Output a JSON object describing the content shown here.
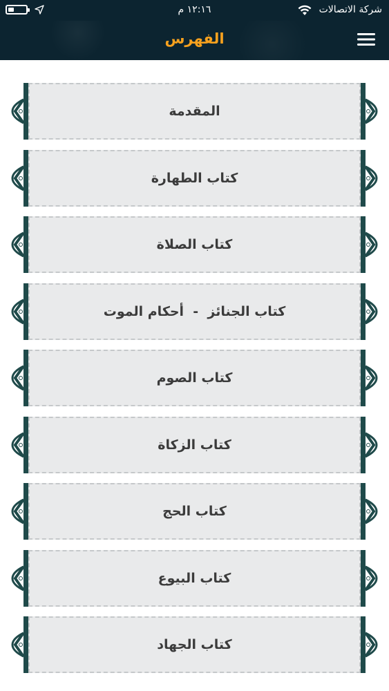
{
  "status_bar": {
    "carrier": "شركة الاتصالات",
    "time": "١٢:١٦ م",
    "battery_level": 0.35,
    "wifi_icon": "wifi-icon",
    "location_icon": "location-arrow-icon",
    "battery_icon": "battery-icon"
  },
  "header": {
    "title": "الفهرس",
    "menu_icon": "hamburger-menu-icon"
  },
  "colors": {
    "header_bg": "#0c2430",
    "title": "#f7a11e",
    "card_bg": "#e9eaeb",
    "ornament": "#1f4a4a"
  },
  "index": {
    "items": [
      {
        "label": "المقدمة"
      },
      {
        "label": "كتاب الطهارة"
      },
      {
        "label": "كتاب الصلاة"
      },
      {
        "label": "كتاب الجنائز  -  أحكام الموت"
      },
      {
        "label": "كتاب الصوم"
      },
      {
        "label": "كتاب الزكاة"
      },
      {
        "label": "كتاب الحج"
      },
      {
        "label": "كتاب البيوع"
      },
      {
        "label": "كتاب الجهاد"
      }
    ]
  }
}
